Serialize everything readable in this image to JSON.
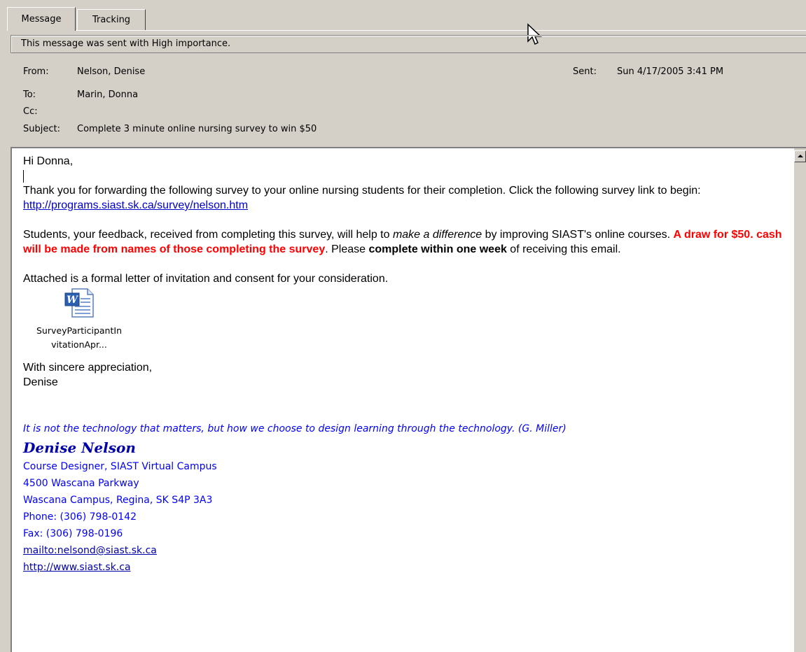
{
  "tabs": [
    {
      "label": "Message",
      "active": true
    },
    {
      "label": "Tracking",
      "active": false
    }
  ],
  "importance_banner": "This message was sent with High importance.",
  "header": {
    "from_label": "From:",
    "from_value": "Nelson, Denise",
    "sent_label": "Sent:",
    "sent_value": "Sun 4/17/2005 3:41 PM",
    "to_label": "To:",
    "to_value": "Marin, Donna",
    "cc_label": "Cc:",
    "cc_value": "",
    "subject_label": "Subject:",
    "subject_value": "Complete 3 minute online nursing survey to win $50"
  },
  "body": {
    "greeting": "Hi Donna,",
    "p1_text": "Thank you for forwarding the following survey to your online nursing students for their completion. Click the following survey link to begin: ",
    "p1_link": "http://programs.siast.sk.ca/survey/nelson.htm",
    "p2_a": "Students, your feedback, received from completing this survey, will help to ",
    "p2_italic": "make a difference",
    "p2_b": " by improving SIAST's online courses. ",
    "p2_red": "A draw for $50. cash will be made from names of those completing the survey",
    "p2_c": ". Please ",
    "p2_bold": "complete within one week",
    "p2_d": " of receiving this email.",
    "p3": "Attached is a formal letter of invitation and consent for your consideration.",
    "attachment": {
      "line1": "SurveyParticipantIn",
      "line2": "vitationApr...",
      "icon": "word-document-icon"
    },
    "closing": "With sincere appreciation,",
    "closing_name": "Denise"
  },
  "signature": {
    "quote": "It is not the technology that matters, but how we choose to design learning through the technology. (G. Miller)",
    "name": "Denise Nelson",
    "title": "Course Designer, SIAST Virtual Campus",
    "address1": "4500 Wascana Parkway",
    "address2": "Wascana Campus, Regina, SK S4P 3A3",
    "phone": "Phone: (306) 798-0142",
    "fax": "Fax: (306) 798-0196",
    "mailto": "mailto:nelsond@siast.sk.ca",
    "web": "http://www.siast.sk.ca"
  },
  "colors": {
    "window_bg": "#d4d0c8",
    "link": "#0000cc",
    "emphasis_red": "#ff0000",
    "signature_blue": "#0000ff"
  }
}
